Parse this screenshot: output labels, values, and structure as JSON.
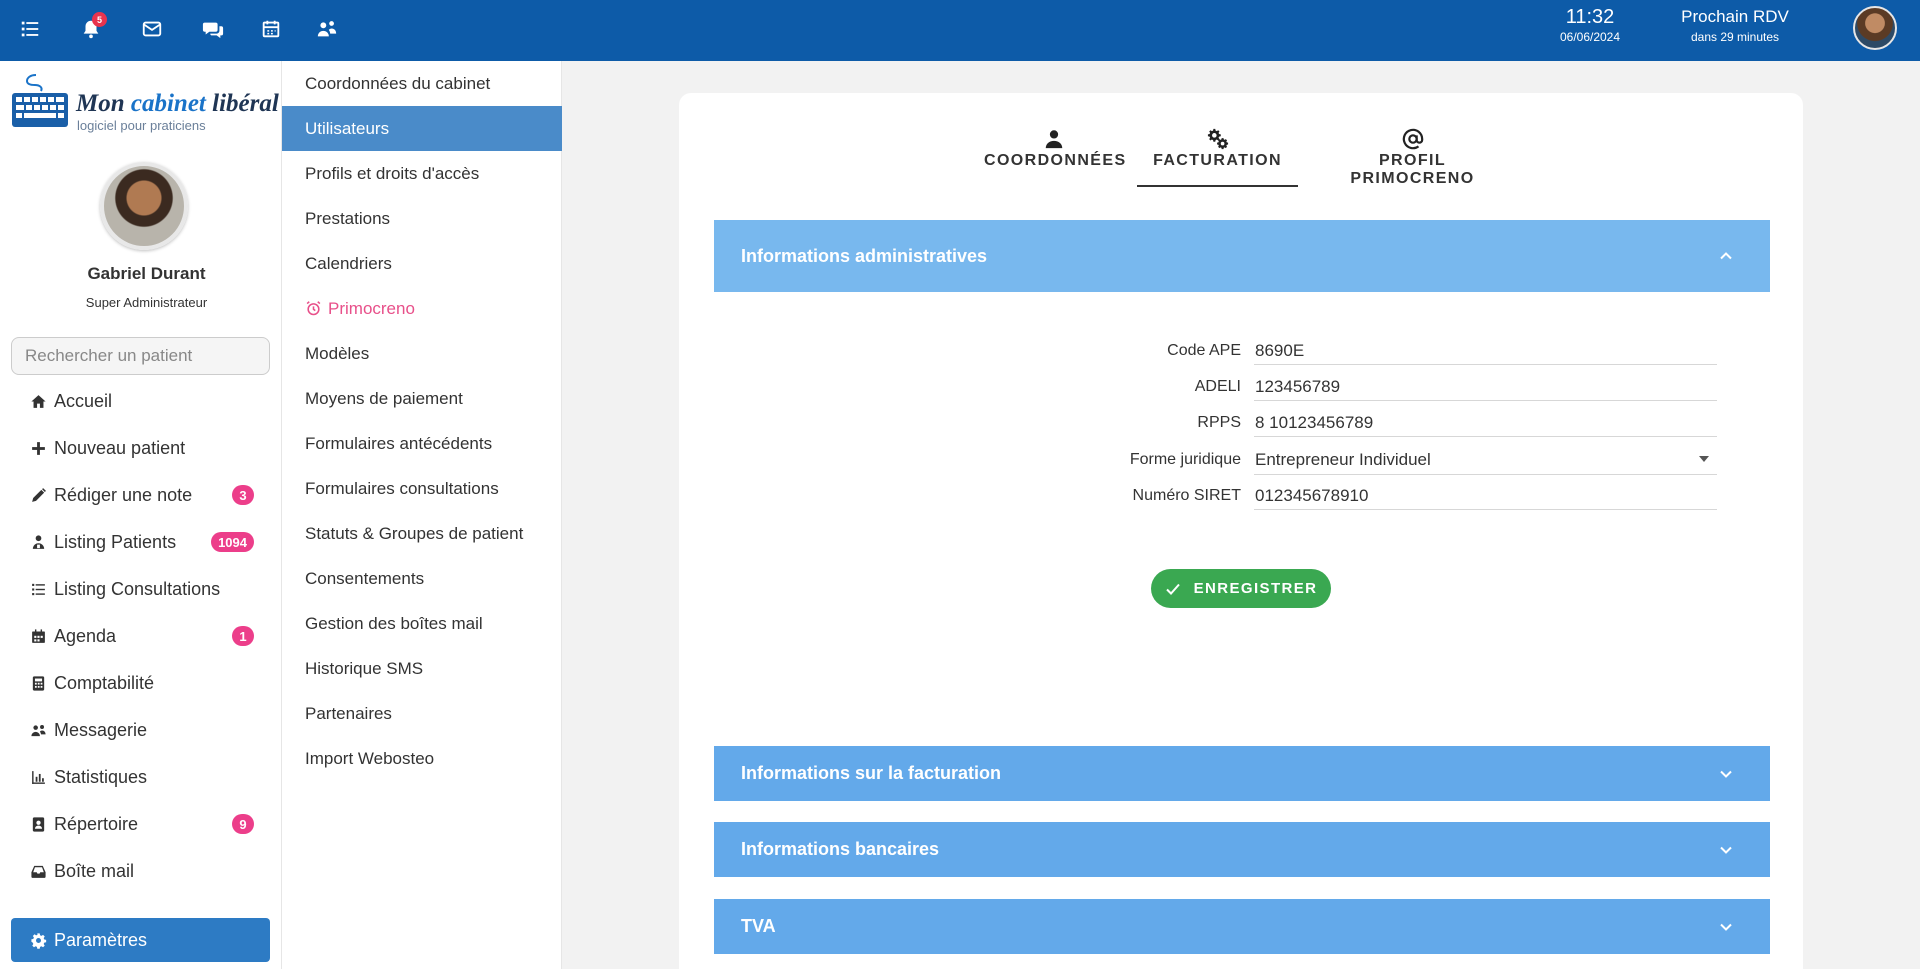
{
  "topbar": {
    "notification_count": "5",
    "time": "11:32",
    "date": "06/06/2024",
    "next_appointment_label": "Prochain RDV",
    "next_appointment_time": "dans 29 minutes"
  },
  "logo": {
    "title_part1": "Mon",
    "title_part2": "cabinet",
    "title_part3": "libéral",
    "subtitle": "logiciel pour praticiens"
  },
  "user": {
    "name": "Gabriel Durant",
    "role": "Super Administrateur"
  },
  "search": {
    "placeholder": "Rechercher un patient"
  },
  "nav": {
    "items": [
      {
        "label": "Accueil"
      },
      {
        "label": "Nouveau patient"
      },
      {
        "label": "Rédiger une note",
        "badge": "3"
      },
      {
        "label": "Listing Patients",
        "badge": "1094"
      },
      {
        "label": "Listing Consultations"
      },
      {
        "label": "Agenda",
        "badge": "1"
      },
      {
        "label": "Comptabilité"
      },
      {
        "label": "Messagerie"
      },
      {
        "label": "Statistiques"
      },
      {
        "label": "Répertoire",
        "badge": "9"
      },
      {
        "label": "Boîte mail"
      },
      {
        "label": "Paramètres"
      }
    ]
  },
  "settings_menu": {
    "items": [
      "Coordonnées du cabinet",
      "Utilisateurs",
      "Profils et droits d'accès",
      "Prestations",
      "Calendriers",
      "Primocreno",
      "Modèles",
      "Moyens de paiement",
      "Formulaires antécédents",
      "Formulaires consultations",
      "Statuts & Groupes de patient",
      "Consentements",
      "Gestion des boîtes mail",
      "Historique SMS",
      "Partenaires",
      "Import Webosteo"
    ]
  },
  "tabs": [
    {
      "label": "COORDONNÉES"
    },
    {
      "label": "FACTURATION"
    },
    {
      "label": "PROFIL PRIMOCRENO"
    }
  ],
  "sections": {
    "admin": "Informations administratives",
    "billing": "Informations sur la facturation",
    "bank": "Informations bancaires",
    "vat": "TVA"
  },
  "form": {
    "ape_label": "Code APE",
    "ape_value": "8690E",
    "adeli_label": "ADELI",
    "adeli_value": "123456789",
    "rpps_label": "RPPS",
    "rpps_value": "8 10123456789",
    "legal_label": "Forme juridique",
    "legal_value": "Entrepreneur Individuel",
    "siret_label": "Numéro SIRET",
    "siret_value": "012345678910"
  },
  "save_button": "ENREGISTRER",
  "colors": {
    "topbar": "#0d5ba8",
    "accent": "#2d7bc4",
    "section_header": "#63a9ea",
    "badge": "#ec3e8a",
    "save": "#3aa851",
    "primocreno": "#e8508a"
  }
}
